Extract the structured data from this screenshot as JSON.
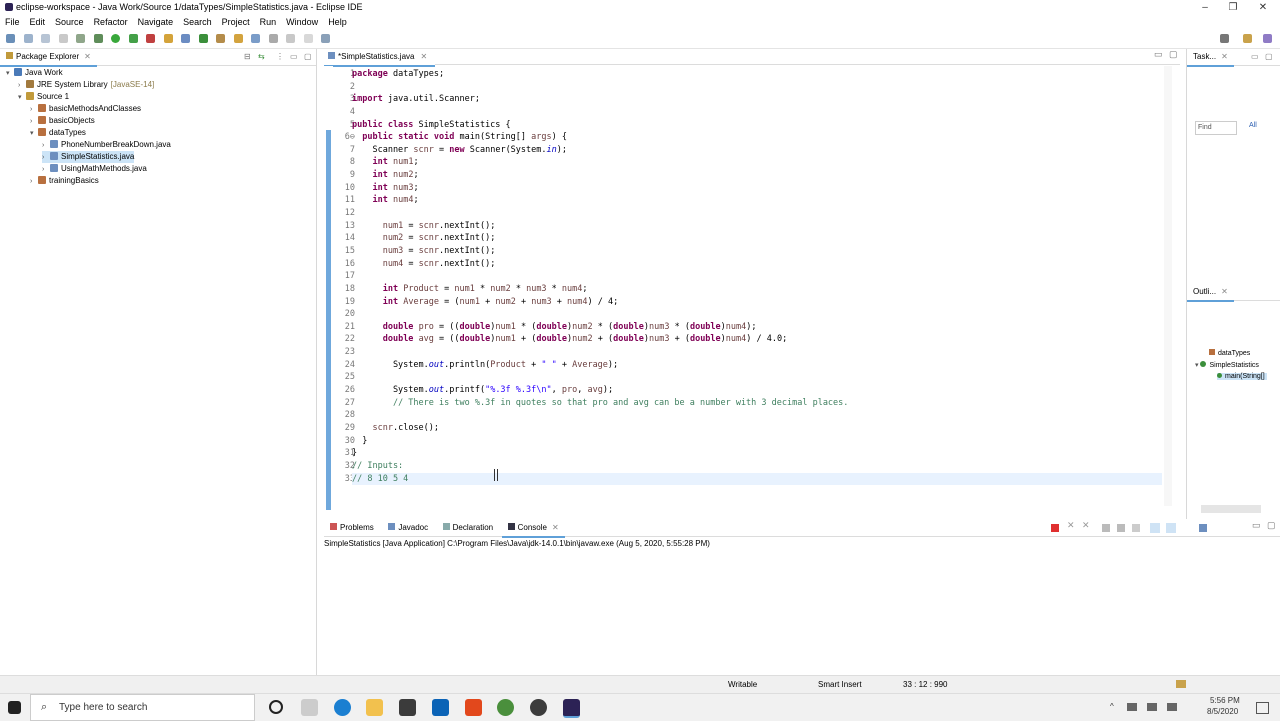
{
  "window": {
    "title": "eclipse-workspace - Java Work/Source 1/dataTypes/SimpleStatistics.java - Eclipse IDE",
    "controls": [
      "–",
      "❐",
      "✕"
    ]
  },
  "menu": [
    "File",
    "Edit",
    "Source",
    "Refactor",
    "Navigate",
    "Search",
    "Project",
    "Run",
    "Window",
    "Help"
  ],
  "package_explorer": {
    "tab": "Package Explorer",
    "tree": [
      {
        "label": "Java Work",
        "arrow": "▾",
        "icon": "project-icon",
        "color": "#4a7ab8"
      },
      {
        "label": "JRE System Library",
        "suffix": "[JavaSE-14]",
        "arrow": "›",
        "icon": "library-icon",
        "color": "#a27a3e"
      },
      {
        "label": "Source 1",
        "arrow": "▾",
        "icon": "source-folder-icon",
        "color": "#c19a3b"
      },
      {
        "label": "basicMethodsAndClasses",
        "arrow": "›",
        "icon": "package-icon",
        "color": "#b8703f"
      },
      {
        "label": "basicObjects",
        "arrow": "›",
        "icon": "package-icon",
        "color": "#b8703f"
      },
      {
        "label": "dataTypes",
        "arrow": "▾",
        "icon": "package-icon",
        "color": "#b8703f"
      },
      {
        "label": "PhoneNumberBreakDown.java",
        "arrow": "›",
        "icon": "java-file-icon",
        "color": "#6d8fbf"
      },
      {
        "label": "SimpleStatistics.java",
        "arrow": "›",
        "icon": "java-file-icon",
        "color": "#6d8fbf"
      },
      {
        "label": "UsingMathMethods.java",
        "arrow": "›",
        "icon": "java-file-icon",
        "color": "#6d8fbf"
      },
      {
        "label": "trainingBasics",
        "arrow": "›",
        "icon": "package-icon",
        "color": "#b8703f"
      }
    ]
  },
  "editor": {
    "tab": "*SimpleStatistics.java",
    "line_numbers": [
      "1",
      "2",
      "3",
      "4",
      "5",
      "6⊖",
      "7",
      "8",
      "9",
      "10",
      "11",
      "12",
      "13",
      "14",
      "15",
      "16",
      "17",
      "18",
      "19",
      "20",
      "21",
      "22",
      "23",
      "24",
      "25",
      "26",
      "27",
      "28",
      "29",
      "30",
      "31",
      "32",
      "33"
    ],
    "lines": [
      [
        {
          "t": "package",
          "c": "kw"
        },
        {
          "t": " dataTypes;"
        }
      ],
      [],
      [
        {
          "t": "import",
          "c": "kw"
        },
        {
          "t": " java.util.Scanner;"
        }
      ],
      [],
      [
        {
          "t": "public class",
          "c": "kw"
        },
        {
          "t": " SimpleStatistics {"
        }
      ],
      [
        {
          "t": "  "
        },
        {
          "t": "public static void",
          "c": "kw"
        },
        {
          "t": " main(String[] "
        },
        {
          "t": "args",
          "c": "vr"
        },
        {
          "t": ") {"
        }
      ],
      [
        {
          "t": "    Scanner "
        },
        {
          "t": "scnr",
          "c": "vr"
        },
        {
          "t": " = "
        },
        {
          "t": "new",
          "c": "kw"
        },
        {
          "t": " Scanner(System."
        },
        {
          "t": "in",
          "c": "fd"
        },
        {
          "t": ");"
        }
      ],
      [
        {
          "t": "    "
        },
        {
          "t": "int",
          "c": "kw"
        },
        {
          "t": " "
        },
        {
          "t": "num1",
          "c": "vr"
        },
        {
          "t": ";"
        }
      ],
      [
        {
          "t": "    "
        },
        {
          "t": "int",
          "c": "kw"
        },
        {
          "t": " "
        },
        {
          "t": "num2",
          "c": "vr"
        },
        {
          "t": ";"
        }
      ],
      [
        {
          "t": "    "
        },
        {
          "t": "int",
          "c": "kw"
        },
        {
          "t": " "
        },
        {
          "t": "num3",
          "c": "vr"
        },
        {
          "t": ";"
        }
      ],
      [
        {
          "t": "    "
        },
        {
          "t": "int",
          "c": "kw"
        },
        {
          "t": " "
        },
        {
          "t": "num4",
          "c": "vr"
        },
        {
          "t": ";"
        }
      ],
      [],
      [
        {
          "t": "      "
        },
        {
          "t": "num1",
          "c": "vr"
        },
        {
          "t": " = "
        },
        {
          "t": "scnr",
          "c": "vr"
        },
        {
          "t": ".nextInt();"
        }
      ],
      [
        {
          "t": "      "
        },
        {
          "t": "num2",
          "c": "vr"
        },
        {
          "t": " = "
        },
        {
          "t": "scnr",
          "c": "vr"
        },
        {
          "t": ".nextInt();"
        }
      ],
      [
        {
          "t": "      "
        },
        {
          "t": "num3",
          "c": "vr"
        },
        {
          "t": " = "
        },
        {
          "t": "scnr",
          "c": "vr"
        },
        {
          "t": ".nextInt();"
        }
      ],
      [
        {
          "t": "      "
        },
        {
          "t": "num4",
          "c": "vr"
        },
        {
          "t": " = "
        },
        {
          "t": "scnr",
          "c": "vr"
        },
        {
          "t": ".nextInt();"
        }
      ],
      [],
      [
        {
          "t": "      "
        },
        {
          "t": "int",
          "c": "kw"
        },
        {
          "t": " "
        },
        {
          "t": "Product",
          "c": "vr"
        },
        {
          "t": " = "
        },
        {
          "t": "num1",
          "c": "vr"
        },
        {
          "t": " * "
        },
        {
          "t": "num2",
          "c": "vr"
        },
        {
          "t": " * "
        },
        {
          "t": "num3",
          "c": "vr"
        },
        {
          "t": " * "
        },
        {
          "t": "num4",
          "c": "vr"
        },
        {
          "t": ";"
        }
      ],
      [
        {
          "t": "      "
        },
        {
          "t": "int",
          "c": "kw"
        },
        {
          "t": " "
        },
        {
          "t": "Average",
          "c": "vr"
        },
        {
          "t": " = ("
        },
        {
          "t": "num1",
          "c": "vr"
        },
        {
          "t": " + "
        },
        {
          "t": "num2",
          "c": "vr"
        },
        {
          "t": " + "
        },
        {
          "t": "num3",
          "c": "vr"
        },
        {
          "t": " + "
        },
        {
          "t": "num4",
          "c": "vr"
        },
        {
          "t": ") / 4;"
        }
      ],
      [],
      [
        {
          "t": "      "
        },
        {
          "t": "double",
          "c": "kw"
        },
        {
          "t": " "
        },
        {
          "t": "pro",
          "c": "vr"
        },
        {
          "t": " = (("
        },
        {
          "t": "double",
          "c": "kw"
        },
        {
          "t": ")"
        },
        {
          "t": "num1",
          "c": "vr"
        },
        {
          "t": " * ("
        },
        {
          "t": "double",
          "c": "kw"
        },
        {
          "t": ")"
        },
        {
          "t": "num2",
          "c": "vr"
        },
        {
          "t": " * ("
        },
        {
          "t": "double",
          "c": "kw"
        },
        {
          "t": ")"
        },
        {
          "t": "num3",
          "c": "vr"
        },
        {
          "t": " * ("
        },
        {
          "t": "double",
          "c": "kw"
        },
        {
          "t": ")"
        },
        {
          "t": "num4",
          "c": "vr"
        },
        {
          "t": ");"
        }
      ],
      [
        {
          "t": "      "
        },
        {
          "t": "double",
          "c": "kw"
        },
        {
          "t": " "
        },
        {
          "t": "avg",
          "c": "vr"
        },
        {
          "t": " = (("
        },
        {
          "t": "double",
          "c": "kw"
        },
        {
          "t": ")"
        },
        {
          "t": "num1",
          "c": "vr"
        },
        {
          "t": " + ("
        },
        {
          "t": "double",
          "c": "kw"
        },
        {
          "t": ")"
        },
        {
          "t": "num2",
          "c": "vr"
        },
        {
          "t": " + ("
        },
        {
          "t": "double",
          "c": "kw"
        },
        {
          "t": ")"
        },
        {
          "t": "num3",
          "c": "vr"
        },
        {
          "t": " + ("
        },
        {
          "t": "double",
          "c": "kw"
        },
        {
          "t": ")"
        },
        {
          "t": "num4",
          "c": "vr"
        },
        {
          "t": ") / 4.0;"
        }
      ],
      [],
      [
        {
          "t": "        System."
        },
        {
          "t": "out",
          "c": "fd"
        },
        {
          "t": ".println("
        },
        {
          "t": "Product",
          "c": "vr"
        },
        {
          "t": " + "
        },
        {
          "t": "\" \"",
          "c": "st"
        },
        {
          "t": " + "
        },
        {
          "t": "Average",
          "c": "vr"
        },
        {
          "t": ");"
        }
      ],
      [],
      [
        {
          "t": "        System."
        },
        {
          "t": "out",
          "c": "fd"
        },
        {
          "t": ".printf("
        },
        {
          "t": "\"%.3f %.3f\\n\"",
          "c": "st"
        },
        {
          "t": ", "
        },
        {
          "t": "pro",
          "c": "vr"
        },
        {
          "t": ", "
        },
        {
          "t": "avg",
          "c": "vr"
        },
        {
          "t": ");"
        }
      ],
      [
        {
          "t": "        "
        },
        {
          "t": "// There is two %.3f in quotes so that pro and avg can be a number with 3 decimal places.",
          "c": "cm"
        }
      ],
      [],
      [
        {
          "t": "    "
        },
        {
          "t": "scnr",
          "c": "vr"
        },
        {
          "t": ".close();"
        }
      ],
      [
        {
          "t": "  }"
        }
      ],
      [
        {
          "t": "}"
        }
      ],
      [
        {
          "t": "// Inputs:",
          "c": "cm"
        }
      ],
      [
        {
          "t": "// 8 10 5 4",
          "c": "cm"
        }
      ]
    ]
  },
  "task_list": {
    "tab": "Task...",
    "find_placeholder": "Find",
    "all_label": "All"
  },
  "outline": {
    "tab": "Outli...",
    "items": [
      "dataTypes",
      "SimpleStatistics",
      "main(String[]"
    ]
  },
  "bottom_tabs": [
    {
      "label": "Problems"
    },
    {
      "label": "Javadoc"
    },
    {
      "label": "Declaration"
    },
    {
      "label": "Console",
      "active": true
    }
  ],
  "console_header": "SimpleStatistics [Java Application] C:\\Program Files\\Java\\jdk-14.0.1\\bin\\javaw.exe (Aug 5, 2020, 5:55:28 PM)",
  "status": {
    "writable": "Writable",
    "insert": "Smart Insert",
    "position": "33 : 12 : 990"
  },
  "taskbar": {
    "search_placeholder": "Type here to search",
    "time": "5:56 PM",
    "date": "8/5/2020"
  }
}
